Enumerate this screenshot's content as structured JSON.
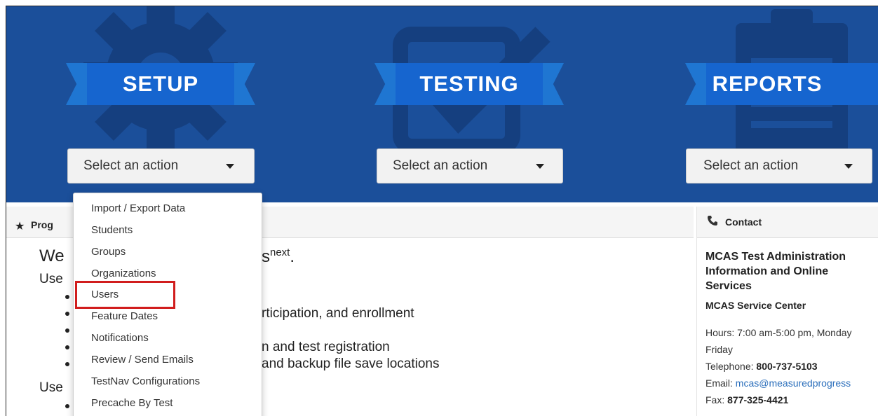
{
  "hero": {
    "sections": [
      {
        "title": "SETUP",
        "action_label": "Select an action"
      },
      {
        "title": "TESTING",
        "action_label": "Select an action"
      },
      {
        "title": "REPORTS",
        "action_label": "Select an action"
      }
    ]
  },
  "setup_menu": {
    "items": [
      "Import / Export Data",
      "Students",
      "Groups",
      "Organizations",
      "Users",
      "Feature Dates",
      "Notifications",
      "Review / Send Emails",
      "TestNav Configurations",
      "Precache By Test"
    ],
    "highlighted": "Users"
  },
  "main_panel": {
    "title_partial": "Prog",
    "welcome_left": "We",
    "welcome_right": "s",
    "welcome_sup": "next",
    "welcome_period": ".",
    "use_1": "Use",
    "use_2": "Use",
    "bullet_participation": "rticipation, and enrollment",
    "bullet_registration": "n and test registration",
    "bullet_backup": "and backup file save locations"
  },
  "contact": {
    "title": "Contact",
    "org_line1": "MCAS Test Administration",
    "org_line2": "Information and Online",
    "org_line3": "Services",
    "service_center": "MCAS Service Center",
    "hours_line1": "Hours: 7:00 am-5:00 pm, Monday",
    "hours_line2": "Friday",
    "telephone_label": "Telephone:",
    "telephone": "800-737-5103",
    "email_label": "Email:",
    "email": "mcas@measuredprogress",
    "fax_label": "Fax:",
    "fax": "877-325-4421"
  },
  "colors": {
    "hero_bg": "#1b4f9a",
    "ribbon": "#1665cf",
    "highlight_border": "#d11d1d",
    "link": "#2a6ebb"
  },
  "icons": [
    "gear-icon",
    "checkbox-icon",
    "clipboard-icon",
    "star-icon",
    "phone-icon",
    "caret-down-icon"
  ]
}
